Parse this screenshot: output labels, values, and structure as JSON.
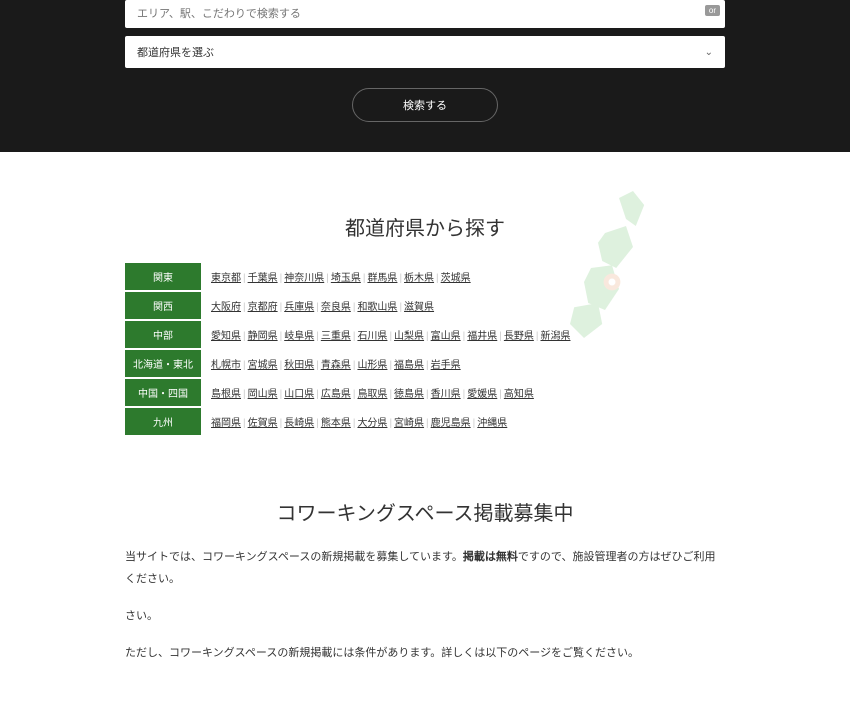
{
  "search": {
    "placeholder": "エリア、駅、こだわりで検索する",
    "badge": "or",
    "select_label": "都道府県を選ぶ",
    "button": "検索する"
  },
  "prefecture_section": {
    "title": "都道府県から探す",
    "regions": [
      {
        "label": "関東",
        "prefs": [
          "東京都",
          "千葉県",
          "神奈川県",
          "埼玉県",
          "群馬県",
          "栃木県",
          "茨城県"
        ]
      },
      {
        "label": "関西",
        "prefs": [
          "大阪府",
          "京都府",
          "兵庫県",
          "奈良県",
          "和歌山県",
          "滋賀県"
        ]
      },
      {
        "label": "中部",
        "prefs": [
          "愛知県",
          "静岡県",
          "岐阜県",
          "三重県",
          "石川県",
          "山梨県",
          "富山県",
          "福井県",
          "長野県",
          "新潟県"
        ]
      },
      {
        "label": "北海道・東北",
        "prefs": [
          "札幌市",
          "宮城県",
          "秋田県",
          "青森県",
          "山形県",
          "福島県",
          "岩手県"
        ]
      },
      {
        "label": "中国・四国",
        "prefs": [
          "島根県",
          "岡山県",
          "山口県",
          "広島県",
          "鳥取県",
          "徳島県",
          "香川県",
          "愛媛県",
          "高知県"
        ]
      },
      {
        "label": "九州",
        "prefs": [
          "福岡県",
          "佐賀県",
          "長崎県",
          "熊本県",
          "大分県",
          "宮崎県",
          "鹿児島県",
          "沖縄県"
        ]
      }
    ]
  },
  "recruit": {
    "title": "コワーキングスペース掲載募集中",
    "p1_a": "当サイトでは、コワーキングスペースの新規掲載を募集しています。",
    "p1_b": "掲載は無料",
    "p1_c": "ですので、施設管理者の方はぜひご利用ください。",
    "p2": "さい。",
    "p3": "ただし、コワーキングスペースの新規掲載には条件があります。詳しくは以下のページをご覧ください。"
  }
}
